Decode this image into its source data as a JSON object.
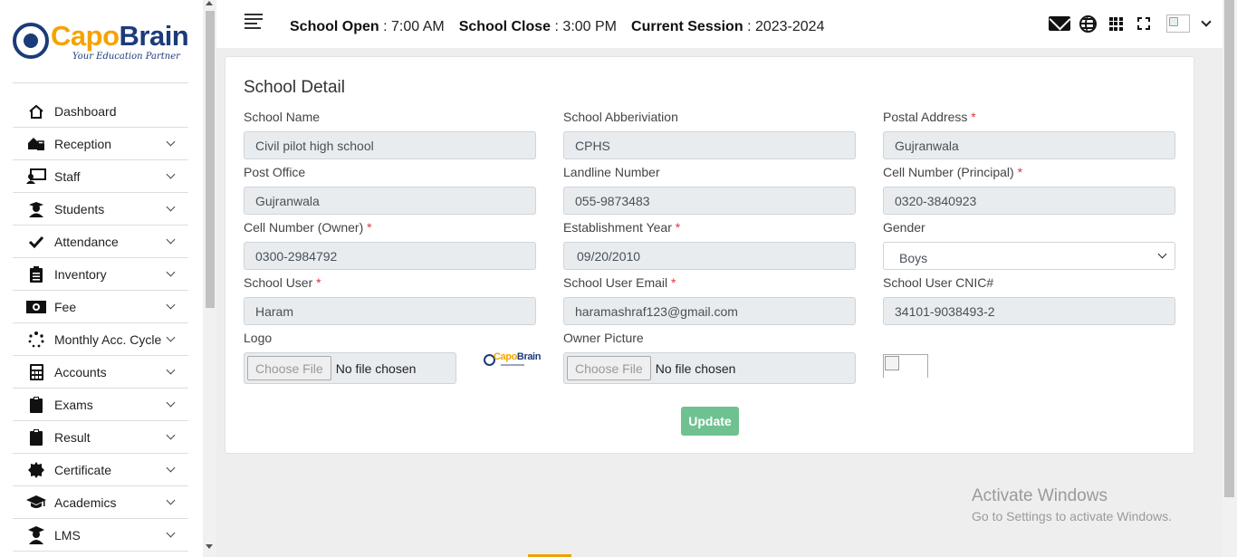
{
  "brand": {
    "name_part1": "Capo",
    "name_part2": "Brain",
    "tagline": "Your Education Partner"
  },
  "sidebar": {
    "items": [
      {
        "label": "Dashboard",
        "icon": "home-icon"
      },
      {
        "label": "Reception",
        "icon": "reception-icon"
      },
      {
        "label": "Staff",
        "icon": "staff-icon"
      },
      {
        "label": "Students",
        "icon": "students-icon"
      },
      {
        "label": "Attendance",
        "icon": "check-icon"
      },
      {
        "label": "Inventory",
        "icon": "clipboard-list-icon"
      },
      {
        "label": "Fee",
        "icon": "money-icon"
      },
      {
        "label": "Monthly Acc. Cycle",
        "icon": "spinner-icon"
      },
      {
        "label": "Accounts",
        "icon": "calculator-icon"
      },
      {
        "label": "Exams",
        "icon": "clipboard-icon"
      },
      {
        "label": "Result",
        "icon": "clipboard-icon"
      },
      {
        "label": "Certificate",
        "icon": "certificate-icon"
      },
      {
        "label": "Academics",
        "icon": "graduation-cap-icon"
      },
      {
        "label": "LMS",
        "icon": "lms-icon"
      }
    ]
  },
  "header": {
    "school_open_label": "School Open",
    "school_open_value": ": 7:00 AM",
    "school_close_label": "School Close",
    "school_close_value": ": 3:00 PM",
    "session_label": "Current Session",
    "session_value": ": 2023-2024"
  },
  "form": {
    "title": "School Detail",
    "school_name": {
      "label": "School Name",
      "value": "Civil pilot high school"
    },
    "abbreviation": {
      "label": "School Abberiviation",
      "value": "CPHS"
    },
    "postal_address": {
      "label": "Postal Address",
      "required": "*",
      "value": "Gujranwala"
    },
    "post_office": {
      "label": "Post Office",
      "value": "Gujranwala"
    },
    "landline": {
      "label": "Landline Number",
      "value": "055-9873483"
    },
    "cell_principal": {
      "label": "Cell Number (Principal)",
      "required": "*",
      "value": "0320-3840923"
    },
    "cell_owner": {
      "label": "Cell Number (Owner)",
      "required": "*",
      "value": "0300-2984792"
    },
    "establishment_year": {
      "label": "Establishment Year",
      "required": "*",
      "value": "09/20/2010"
    },
    "gender": {
      "label": "Gender",
      "value": "Boys"
    },
    "school_user": {
      "label": "School User",
      "required": "*",
      "value": "Haram"
    },
    "school_user_email": {
      "label": "School User Email",
      "required": "*",
      "value": "haramashraf123@gmail.com"
    },
    "school_user_cnic": {
      "label": "School User CNIC#",
      "value": "34101-9038493-2"
    },
    "logo": {
      "label": "Logo",
      "button": "Choose File",
      "status": "No file chosen"
    },
    "owner_picture": {
      "label": "Owner Picture",
      "button": "Choose File",
      "status": "No file chosen"
    },
    "update_button": "Update"
  },
  "watermark": {
    "line1": "Activate Windows",
    "line2": "Go to Settings to activate Windows."
  },
  "colors": {
    "brand_orange": "#f5a300",
    "brand_navy": "#1c3b7a",
    "update_green": "#6fc290",
    "required_red": "#dc3545"
  }
}
